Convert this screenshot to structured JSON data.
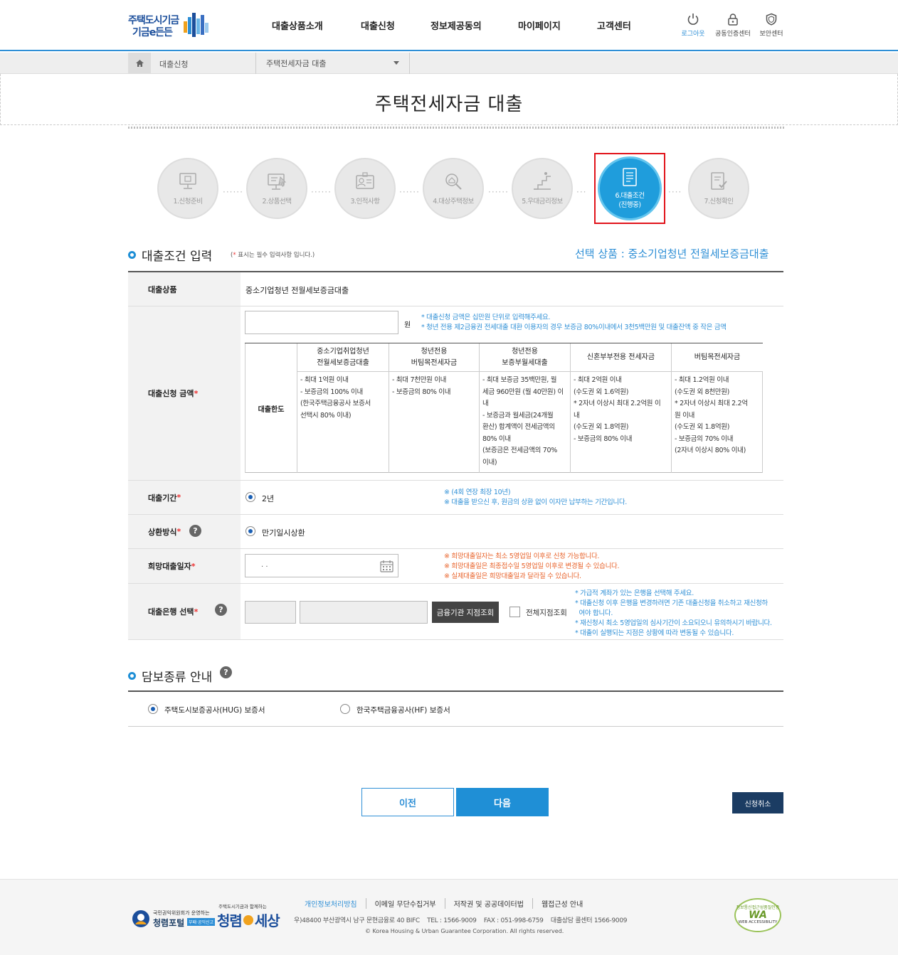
{
  "header": {
    "logo_line1": "주택도시기금",
    "logo_line2": "기금e든든",
    "nav": [
      "대출상품소개",
      "대출신청",
      "정보제공동의",
      "마이페이지",
      "고객센터"
    ],
    "util": [
      {
        "label": "로그아웃",
        "icon": "power-icon"
      },
      {
        "label": "공동인증센터",
        "icon": "lock-icon"
      },
      {
        "label": "보안센터",
        "icon": "shield-icon"
      }
    ]
  },
  "breadcrumb": {
    "level1": "대출신청",
    "level2": "주택전세자금 대출"
  },
  "page_title": "주택전세자금 대출",
  "steps": [
    {
      "label": "1.신청준비",
      "icon": "computer-icon"
    },
    {
      "label": "2.상품선택",
      "icon": "monitor-select-icon"
    },
    {
      "label": "3.인적사항",
      "icon": "id-card-icon"
    },
    {
      "label": "4.대상주택정보",
      "icon": "search-house-icon"
    },
    {
      "label": "5.우대금리정보",
      "icon": "stairs-icon"
    },
    {
      "label": "6.대출조건",
      "label2": "(진행중)",
      "icon": "document-list-icon"
    },
    {
      "label": "7.신청확인",
      "icon": "check-document-icon"
    }
  ],
  "section1": {
    "title": "대출조건 입력",
    "req_note_pre": "(",
    "req_note_star": "*",
    "req_note_post": " 표시는 필수 입력사항 입니다.)",
    "selected_product": "선택 상품 : 중소기업청년 전월세보증금대출"
  },
  "form": {
    "product_label": "대출상품",
    "product_value": "중소기업청년 전월세보증금대출",
    "amount_label": "대출신청 금액",
    "amount_unit": "원",
    "amount_value": "",
    "amount_notes": [
      "* 대출신청 금액은 십만원 단위로 입력해주세요.",
      "* 청년 전용 제2금융권 전세대출 대환 이용자의 경우 보증금 80%이내에서 3천5백만원 및 대출잔액 중 작은 금액"
    ],
    "limit_table": {
      "side": "대출한도",
      "headers": [
        [
          "중소기업취업청년",
          "전월세보증금대출"
        ],
        [
          "청년전용",
          "버팀목전세자금"
        ],
        [
          "청년전용",
          "보증부월세대출"
        ],
        [
          "신혼부부전용 전세자금"
        ],
        [
          "버팀목전세자금"
        ]
      ],
      "cells": [
        [
          "- 최대 1억원 이내",
          "- 보증금의 100% 이내",
          "(한국주택금융공사 보증서",
          "선택시 80% 이내)"
        ],
        [
          "- 최대 7천만원 이내",
          "- 보증금의 80% 이내"
        ],
        [
          "- 최대 보증금 35백만원, 월",
          "세금 960만원 (월 40만원) 이",
          "내",
          "- 보증금과 월세금(24개월",
          "환산) 합계액이 전세금액의",
          "80% 이내",
          "(보증금은 전세금액의 70%",
          "이내)"
        ],
        [
          "- 최대 2억원 이내",
          "(수도권 외 1.6억원)",
          "* 2자녀 이상시 최대 2.2억원 이",
          "내",
          " (수도권 외 1.8억원)",
          "- 보증금의 80% 이내"
        ],
        [
          "- 최대 1.2억원 이내",
          "(수도권 외 8천만원)",
          "* 2자녀 이상시 최대 2.2억",
          "원 이내",
          "(수도권 외 1.8억원)",
          "- 보증금의 70% 이내",
          "(2자녀 이상시 80% 이내)"
        ]
      ]
    },
    "period_label": "대출기간",
    "period_value": "2년",
    "period_notes": [
      "※ (4회 연장 최장 10년)",
      "※ 대출을 받으신 후, 원금의 상환 없이 이자만 납부하는 기간입니다."
    ],
    "repay_label": "상환방식",
    "repay_value": "만기일시상환",
    "date_label": "희망대출일자",
    "date_value": ". .",
    "date_notes": [
      "※ 희망대출일자는 최소 5영업일 이후로 신청 가능합니다.",
      "※ 희망대출일은 최종접수일 5영업일 이후로 변경될 수 있습니다.",
      "※ 실제대출일은 희망대출일과 달라질 수 있습니다."
    ],
    "bank_label": "대출은행 선택",
    "bank_button": "금융기관 지점조회",
    "all_branch_label": "전체지점조회",
    "bank_notes": [
      "* 가급적 계좌가 있는 은행을 선택해 주세요.",
      "* 대출신청 이후 은행을 변경하려면 기존 대출신청을 취소하고 재신청하",
      "  여야 합니다.",
      "* 재신청시 최소 5영업일의 심사기간이 소요되오니 유의하시기 바랍니다.",
      "* 대출이 실행되는 지점은 상황에 따라 변동될 수 있습니다."
    ],
    "required_star": "*",
    "help": "?"
  },
  "section2": {
    "title": "담보종류 안내",
    "options": [
      {
        "label": "주택도시보증공사(HUG) 보증서",
        "checked": true
      },
      {
        "label": "한국주택금융공사(HF) 보증서",
        "checked": false
      }
    ]
  },
  "buttons": {
    "prev": "이전",
    "next": "다음",
    "cancel": "신청취소"
  },
  "footer": {
    "links": [
      "개인정보처리방침",
      "이메일 무단수집거부",
      "저작권 및 공공데이터법",
      "웹접근성 안내"
    ],
    "address": "우)48400 부산광역시 남구 문현금융로 40 BIFC    TEL : 1566-9009    FAX : 051-998-6759    대출상담 콜센터 1566-9009",
    "copyright": "© Korea Housing & Urban Guarantee Corporation. All rights reserved.",
    "logo1_top": "국민권익위원회가 운영하는",
    "logo1_main": "청렴포털",
    "logo1_tag": "부패·공익신고",
    "logo2_top": "주택도시기금과 함께하는",
    "logo2_main": "청렴",
    "logo2_main2": "세상",
    "wa_mark": "WA",
    "wa_text": "WEB ACCESSIBILITY",
    "wa_ring": "정보통신접근성품질인증"
  },
  "colors": {
    "accent": "#1f8fd6",
    "highlight": "#e1141b",
    "dark_button": "#444444",
    "cancel": "#1b3c63"
  }
}
